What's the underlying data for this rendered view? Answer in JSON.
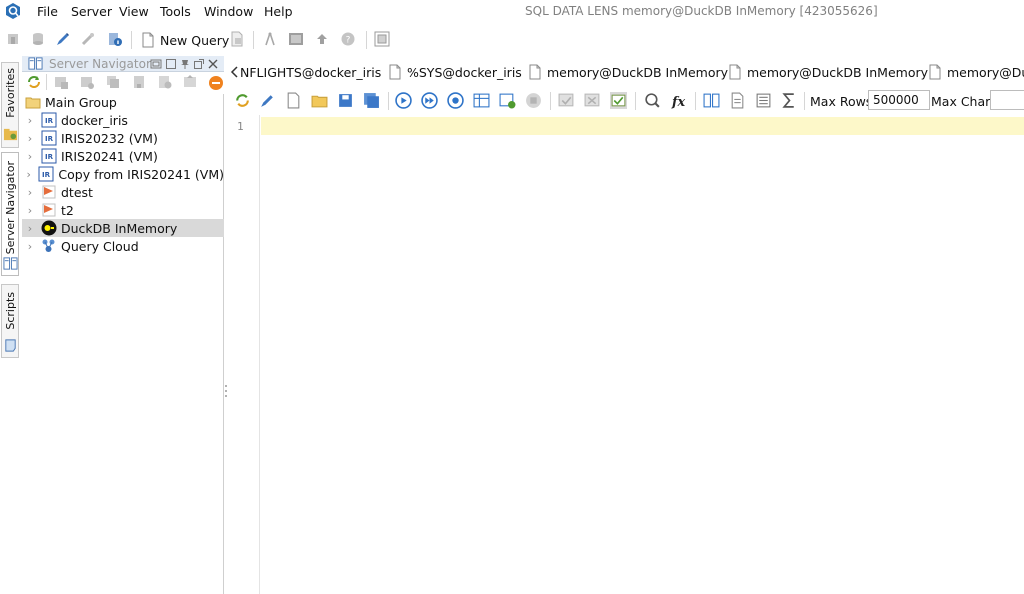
{
  "menubar": {
    "items": [
      "File",
      "Server",
      "View",
      "Tools",
      "Window",
      "Help"
    ],
    "window_title": "SQL DATA LENS  memory@DuckDB InMemory [423055626]"
  },
  "toolbar": {
    "new_query_label": "New Query"
  },
  "left_tabs": {
    "favorites": "Favorites",
    "server_navigator": "Server Navigator",
    "scripts": "Scripts"
  },
  "navigator": {
    "title": "Server Navigator",
    "tree": [
      {
        "label": "Main Group",
        "icon": "folder-icon"
      },
      {
        "label": "docker_iris",
        "icon": "iris-server-icon"
      },
      {
        "label": "IRIS20232 (VM)",
        "icon": "iris-server-icon"
      },
      {
        "label": "IRIS20241 (VM)",
        "icon": "iris-server-icon"
      },
      {
        "label": "Copy from IRIS20241 (VM)",
        "icon": "iris-server-icon"
      },
      {
        "label": "dtest",
        "icon": "generic-db-icon"
      },
      {
        "label": "t2",
        "icon": "generic-db-icon"
      },
      {
        "label": "DuckDB InMemory",
        "icon": "duckdb-icon",
        "selected": true
      },
      {
        "label": "Query Cloud",
        "icon": "query-cloud-icon"
      }
    ]
  },
  "editor_tabs": [
    {
      "label": "NFLIGHTS@docker_iris"
    },
    {
      "label": "%SYS@docker_iris"
    },
    {
      "label": "memory@DuckDB InMemory"
    },
    {
      "label": "memory@DuckDB InMemory"
    },
    {
      "label": "memory@Duc"
    }
  ],
  "editor_toolbar": {
    "max_rows_label": "Max Rows:",
    "max_rows_value": "500000",
    "max_chars_label": "Max Chars:"
  },
  "editor": {
    "line_numbers": [
      "1"
    ]
  },
  "colors": {
    "current_line": "#fdf8c9",
    "header_bg": "#e4ecf6",
    "selected_row": "#d9d9d9"
  }
}
